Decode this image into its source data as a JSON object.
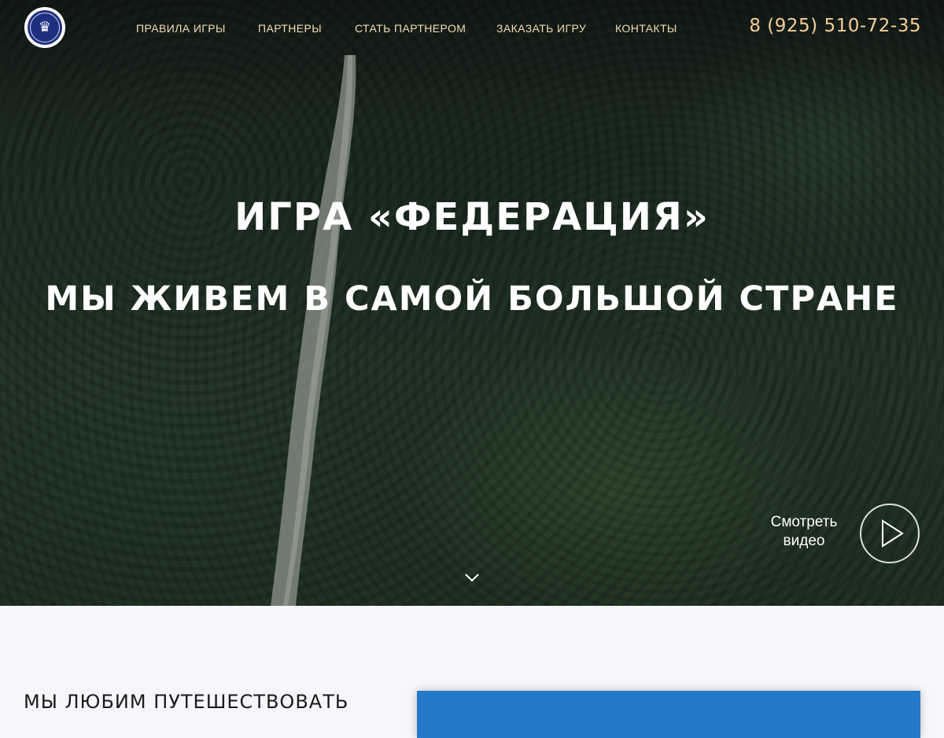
{
  "header": {
    "nav": [
      {
        "label": "ПРАВИЛА ИГРЫ"
      },
      {
        "label": "ПАРТНЕРЫ"
      },
      {
        "label": "СТАТЬ ПАРТНЕРОМ"
      },
      {
        "label": "ЗАКАЗАТЬ ИГРУ"
      },
      {
        "label": "КОНТАКТЫ"
      }
    ],
    "phone": "8 (925) 510-72-35"
  },
  "hero": {
    "title": "ИГРА «ФЕДЕРАЦИЯ»",
    "subtitle": "МЫ ЖИВЕМ В САМОЙ БОЛЬШОЙ СТРАНЕ",
    "video": {
      "line1": "Смотреть",
      "line2": "видео"
    }
  },
  "section": {
    "title": "МЫ ЛЮБИМ ПУТЕШЕСТВОВАТЬ"
  },
  "colors": {
    "nav": "#f3dbb3",
    "phone": "#f4cf98",
    "card": "#2479c8"
  },
  "icons": [
    "federation-logo",
    "play-icon",
    "chevron-down-icon"
  ]
}
